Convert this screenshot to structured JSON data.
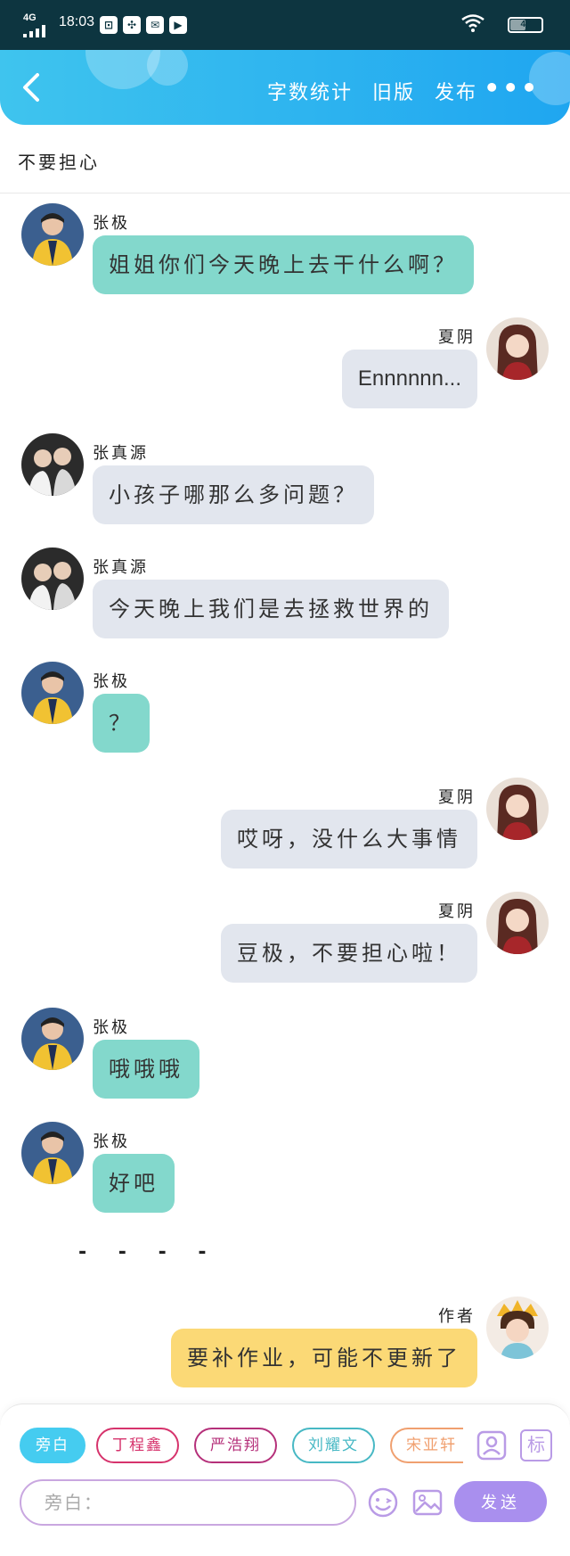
{
  "status_bar": {
    "network": "4G",
    "time": "18:03",
    "battery": "48",
    "battery_level": 0.48
  },
  "header": {
    "actions": [
      "字数统计",
      "旧版",
      "发布"
    ],
    "more_label": "•••"
  },
  "chat_title": "不要担心",
  "messages": [
    {
      "side": "left",
      "name": "张极",
      "text": "姐姐你们今天晚上去干什么啊？",
      "color": "teal",
      "avatar": "boy-yellow"
    },
    {
      "side": "right",
      "name": "夏阴",
      "text": "Ennnnnn...",
      "color": "grey",
      "avatar": "girl-red"
    },
    {
      "side": "left",
      "name": "张真源",
      "text": "小孩子哪那么多问题？",
      "color": "grey",
      "avatar": "boys-pair"
    },
    {
      "side": "left",
      "name": "张真源",
      "text": "今天晚上我们是去拯救世界的",
      "color": "grey",
      "avatar": "boys-pair"
    },
    {
      "side": "left",
      "name": "张极",
      "text": "？",
      "color": "teal",
      "avatar": "boy-yellow"
    },
    {
      "side": "right",
      "name": "夏阴",
      "text": "哎呀，没什么大事情",
      "color": "grey",
      "avatar": "girl-red"
    },
    {
      "side": "right",
      "name": "夏阴",
      "text": "豆极，不要担心啦！",
      "color": "grey",
      "avatar": "girl-red"
    },
    {
      "side": "left",
      "name": "张极",
      "text": "哦哦哦",
      "color": "teal",
      "avatar": "boy-yellow"
    },
    {
      "side": "left",
      "name": "张极",
      "text": "好吧",
      "color": "teal",
      "avatar": "boy-yellow"
    },
    {
      "side": "right",
      "name": "作者",
      "text": "要补作业，可能不更新了",
      "color": "yellow",
      "avatar": "boy-crown"
    }
  ],
  "separator": "- - - -",
  "input": {
    "chips": [
      {
        "label": "旁白",
        "color": "#45ccf0",
        "active": true
      },
      {
        "label": "丁程鑫",
        "color": "#d6336c",
        "active": false
      },
      {
        "label": "严浩翔",
        "color": "#b5307a",
        "active": false
      },
      {
        "label": "刘耀文",
        "color": "#47b8c4",
        "active": false
      },
      {
        "label": "宋亚轩",
        "color": "#f0a070",
        "active": false
      }
    ],
    "person_icon": "person-card-icon",
    "tag_icon_label": "标",
    "placeholder": "旁白：",
    "emoji_icon": "emoji-icon",
    "image_icon": "image-icon",
    "send_label": "发送"
  },
  "colors": {
    "teal": "#83d8cc",
    "grey": "#e2e6ee",
    "yellow": "#fbd976",
    "header": "#1fa6f0",
    "send": "#a98fee"
  }
}
